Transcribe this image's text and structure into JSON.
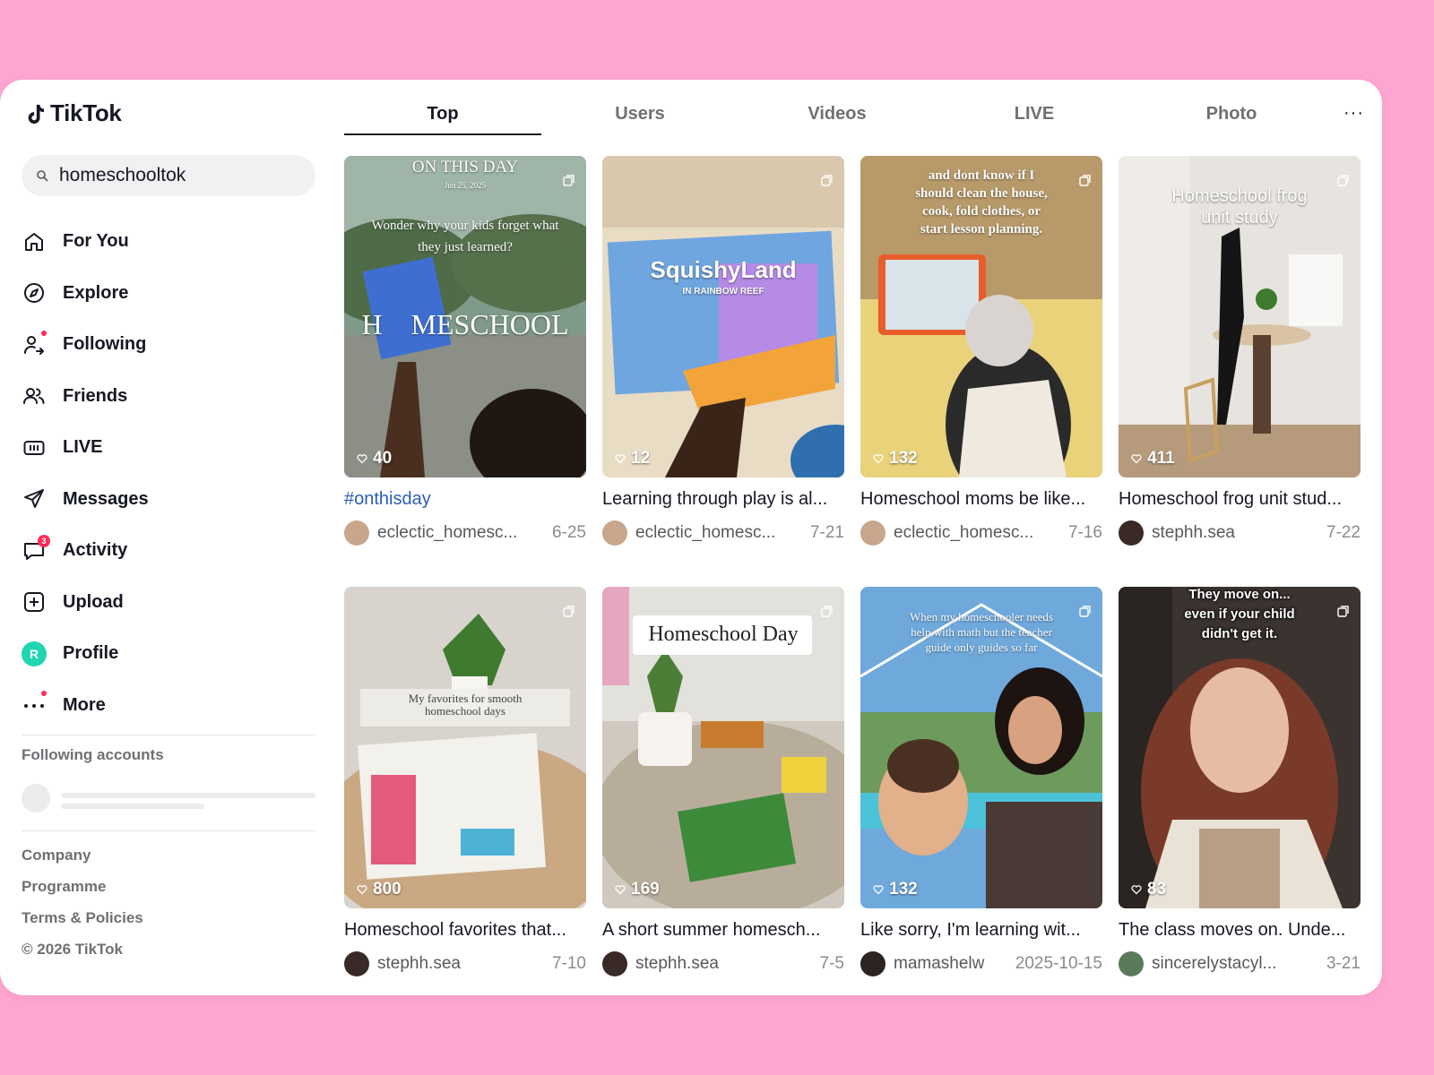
{
  "app": {
    "name": "TikTok"
  },
  "search": {
    "value": "homeschooltok"
  },
  "nav": [
    {
      "label": "For You",
      "icon": "home-icon"
    },
    {
      "label": "Explore",
      "icon": "compass-icon"
    },
    {
      "label": "Following",
      "icon": "following-icon",
      "dot": true
    },
    {
      "label": "Friends",
      "icon": "friends-icon"
    },
    {
      "label": "LIVE",
      "icon": "live-icon"
    },
    {
      "label": "Messages",
      "icon": "send-icon"
    },
    {
      "label": "Activity",
      "icon": "message-bubble-icon",
      "badge": "3"
    },
    {
      "label": "Upload",
      "icon": "plus-square-icon"
    },
    {
      "label": "Profile",
      "icon": "avatar-icon",
      "avatar_letter": "R"
    },
    {
      "label": "More",
      "icon": "more-dots-icon",
      "dot": true
    }
  ],
  "following_accounts": {
    "title": "Following accounts"
  },
  "footer": [
    "Company",
    "Programme",
    "Terms & Policies",
    "© 2026 TikTok"
  ],
  "tabs": [
    "Top",
    "Users",
    "Videos",
    "LIVE",
    "Photo"
  ],
  "active_tab": "Top",
  "more_tab": "···",
  "videos": [
    {
      "caption": "#onthisday",
      "is_tag": true,
      "likes": "40",
      "user": "eclectic_homesc...",
      "date": "6-25",
      "overlay": [
        "ON THIS DAY",
        "Jun 25, 2025",
        "Wonder why your kids forget what",
        "they just learned?",
        "H    MESCHOOL"
      ]
    },
    {
      "caption": "Learning through play is al...",
      "likes": "12",
      "user": "eclectic_homesc...",
      "date": "7-21",
      "overlay": [
        "SquishyLand",
        "IN RAINBOW REEF"
      ]
    },
    {
      "caption": "Homeschool moms be like...",
      "likes": "132",
      "user": "eclectic_homesc...",
      "date": "7-16",
      "overlay": [
        "and dont know if I",
        "should clean the house,",
        "cook, fold clothes, or",
        "start lesson planning."
      ]
    },
    {
      "caption": "Homeschool frog unit stud...",
      "likes": "411",
      "user": "stephh.sea",
      "date": "7-22",
      "overlay": [
        "Homeschool frog",
        "unit study"
      ]
    },
    {
      "caption": "Homeschool favorites that...",
      "likes": "800",
      "user": "stephh.sea",
      "date": "7-10",
      "overlay": [
        "My favorites for smooth",
        "homeschool days"
      ]
    },
    {
      "caption": "A short summer homesch...",
      "likes": "169",
      "user": "stephh.sea",
      "date": "7-5",
      "overlay": [
        "Homeschool Day"
      ]
    },
    {
      "caption": "Like sorry, I'm learning wit...",
      "likes": "132",
      "user": "mamashelw",
      "date": "2025-10-15",
      "overlay": [
        "When my homeschooler needs",
        "help with math but the teacher",
        "guide only guides so far"
      ]
    },
    {
      "caption": "The class moves on. Unde...",
      "likes": "83",
      "user": "sincerelystacyl...",
      "date": "3-21",
      "overlay": [
        "They move on...",
        "even if your child",
        "didn't get it."
      ]
    }
  ]
}
